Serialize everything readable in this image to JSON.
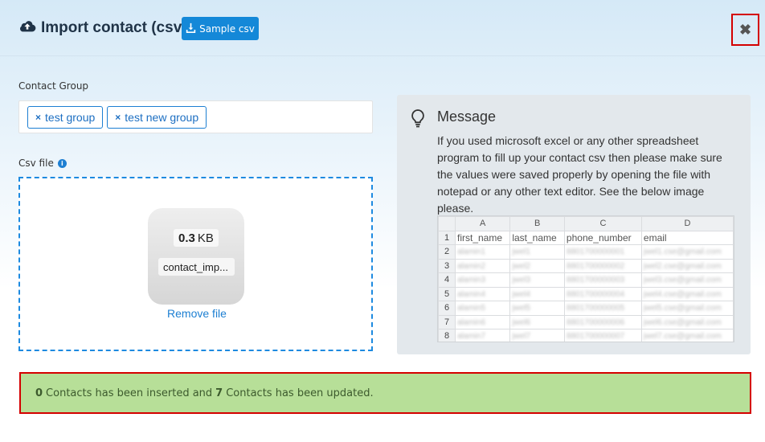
{
  "header": {
    "title": "Import contact (csv)",
    "title_icon": "cloud-upload-icon",
    "sample_button_label": "Sample csv",
    "sample_button_icon": "download-icon",
    "close_icon": "close-icon",
    "close_glyph": "✖"
  },
  "contact_group": {
    "label": "Contact Group",
    "tags": [
      {
        "label": "test group",
        "remove_glyph": "×"
      },
      {
        "label": "test new group",
        "remove_glyph": "×"
      }
    ]
  },
  "csv_file": {
    "label": "Csv file",
    "info_glyph": "i",
    "file": {
      "size_value": "0.3",
      "size_unit": "KB",
      "name": "contact_imp..."
    },
    "remove_label": "Remove file"
  },
  "message": {
    "icon": "lightbulb-icon",
    "title": "Message",
    "text": "If you used microsoft excel or any other spreadsheet program to fill up your contact csv then please make sure the values were saved properly by opening the file with notepad or any other text editor. See the below image please.",
    "sheet": {
      "columns": [
        "A",
        "B",
        "C",
        "D"
      ],
      "header_row": {
        "num": "1",
        "cells": [
          "first_name",
          "last_name",
          "phone_number",
          "email"
        ]
      },
      "rows": [
        {
          "num": "2",
          "cells": [
            "alamin1",
            "jwel1",
            "8801700000001",
            "jwel1.cse@gmail.com"
          ]
        },
        {
          "num": "3",
          "cells": [
            "alamin2",
            "jwel2",
            "8801700000002",
            "jwel2.cse@gmail.com"
          ]
        },
        {
          "num": "4",
          "cells": [
            "alamin3",
            "jwel3",
            "8801700000003",
            "jwel3.cse@gmail.com"
          ]
        },
        {
          "num": "5",
          "cells": [
            "alamin4",
            "jwel4",
            "8801700000004",
            "jwel4.cse@gmail.com"
          ]
        },
        {
          "num": "6",
          "cells": [
            "alamin5",
            "jwel5",
            "8801700000005",
            "jwel5.cse@gmail.com"
          ]
        },
        {
          "num": "7",
          "cells": [
            "alamin6",
            "jwel6",
            "8801700000006",
            "jwel6.cse@gmail.com"
          ]
        },
        {
          "num": "8",
          "cells": [
            "alamin7",
            "jwel7",
            "8801700000007",
            "jwel7.cse@gmail.com"
          ]
        }
      ]
    }
  },
  "result": {
    "inserted_count": "0",
    "inserted_text": "Contacts has been inserted and",
    "updated_count": "7",
    "updated_text": "Contacts has been updated."
  },
  "colors": {
    "primary": "#1488d8",
    "success_bg": "#b7df98",
    "highlight_border": "#d40000"
  }
}
